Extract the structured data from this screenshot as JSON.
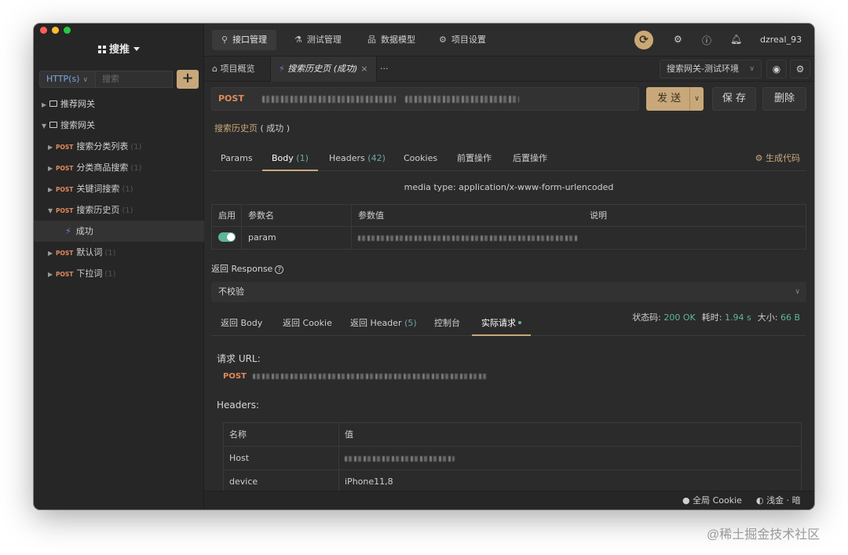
{
  "sidebar": {
    "project": "搜推",
    "http_select": "HTTP(s)",
    "search_placeholder": "搜索",
    "add_label": "+",
    "tree": [
      {
        "type": "folder",
        "label": "推荐网关",
        "expanded": false
      },
      {
        "type": "folder",
        "label": "搜索网关",
        "expanded": true
      },
      {
        "type": "api",
        "method": "POST",
        "label": "搜索分类列表",
        "count": "(1)"
      },
      {
        "type": "api",
        "method": "POST",
        "label": "分类商品搜索",
        "count": "(1)"
      },
      {
        "type": "api",
        "method": "POST",
        "label": "关键词搜索",
        "count": "(1)"
      },
      {
        "type": "api",
        "method": "POST",
        "label": "搜索历史页",
        "count": "(1)",
        "expanded": true
      },
      {
        "type": "case",
        "label": "成功"
      },
      {
        "type": "api",
        "method": "POST",
        "label": "默认词",
        "count": "(1)"
      },
      {
        "type": "api",
        "method": "POST",
        "label": "下拉词",
        "count": "(1)"
      }
    ]
  },
  "topnav": {
    "tabs": [
      "接口管理",
      "测试管理",
      "数据模型",
      "项目设置"
    ],
    "username": "dzreal_93"
  },
  "doc_tabs": {
    "overview": "项目概览",
    "current": "搜索历史页 (成功)",
    "more": "···",
    "env": "搜索网关-测试环境"
  },
  "request": {
    "method": "POST",
    "send": "发 送",
    "save": "保 存",
    "delete": "删除",
    "case_name": "搜索历史页",
    "case_sub": "( 成功 )"
  },
  "params_tabs": {
    "params": "Params",
    "body": "Body",
    "body_count": "(1)",
    "headers": "Headers",
    "headers_count": "(42)",
    "cookies": "Cookies",
    "pre": "前置操作",
    "post": "后置操作",
    "gen_code": "生成代码"
  },
  "media_type": "media type: application/x-www-form-urlencoded",
  "param_table": {
    "headers": [
      "启用",
      "参数名",
      "参数值",
      "说明"
    ],
    "rows": [
      {
        "name": "param"
      }
    ]
  },
  "response": {
    "title": "返回 Response",
    "validate": "不校验",
    "tabs": {
      "body": "返回 Body",
      "cookie": "返回 Cookie",
      "header": "返回 Header",
      "header_count": "(5)",
      "console": "控制台",
      "actual": "实际请求"
    },
    "status_label": "状态码:",
    "status": "200 OK",
    "time_label": "耗时:",
    "time": "1.94 s",
    "size_label": "大小:",
    "size": "66 B"
  },
  "actual_request": {
    "url_label": "请求 URL:",
    "method": "POST",
    "headers_label": "Headers:",
    "table_headers": [
      "名称",
      "值"
    ],
    "rows": [
      {
        "name": "Host",
        "value": ""
      },
      {
        "name": "device",
        "value": "iPhone11,8"
      }
    ]
  },
  "statusbar": {
    "cookie": "全局 Cookie",
    "theme": "浅金 · 暗"
  },
  "watermark": "@稀土掘金技术社区",
  "colors": {
    "accent": "#c8a87a",
    "post": "#e08a5c",
    "success": "#5fb49c"
  }
}
